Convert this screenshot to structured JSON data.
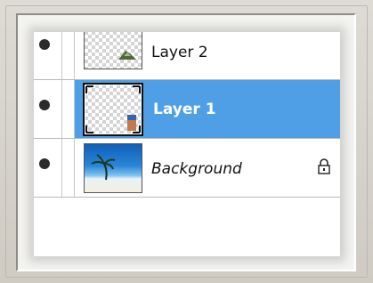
{
  "layers_panel": {
    "layers": [
      {
        "name": "Layer 2",
        "visible": true,
        "selected": false,
        "thumbnail": "transparent-checkerboard-with-image",
        "locked": false
      },
      {
        "name": "Layer 1",
        "visible": true,
        "selected": true,
        "thumbnail": "transparent-checkerboard-with-image",
        "locked": false
      },
      {
        "name": "Background",
        "visible": true,
        "selected": false,
        "thumbnail": "beach-photo",
        "locked": true
      }
    ]
  },
  "colors": {
    "selection": "#4f9fe6",
    "frame": "#d6d3cc"
  },
  "icons": {
    "visibility": "eye-icon",
    "lock": "lock-icon"
  }
}
